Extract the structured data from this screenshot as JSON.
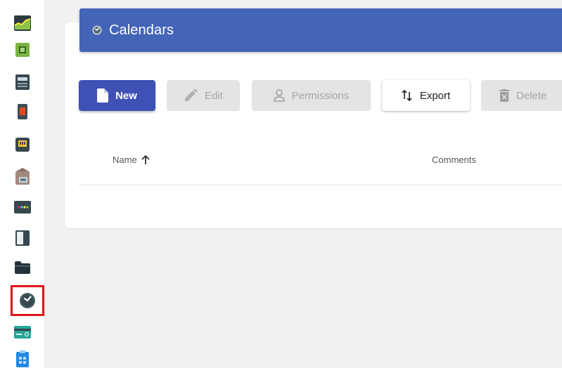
{
  "sidebar": {
    "items": [
      {
        "icon": "chart-icon"
      },
      {
        "icon": "chip-icon"
      },
      {
        "icon": "server-icon"
      },
      {
        "icon": "device-icon"
      },
      {
        "icon": "network-port-icon"
      },
      {
        "icon": "package-icon"
      },
      {
        "icon": "dashboard-icon"
      },
      {
        "icon": "panel-icon"
      },
      {
        "icon": "folder-icon"
      },
      {
        "icon": "clock-icon",
        "active": true
      },
      {
        "icon": "card-icon"
      },
      {
        "icon": "clipboard-icon"
      }
    ]
  },
  "header": {
    "title": "Calendars",
    "icon": "clock-icon"
  },
  "toolbar": {
    "new_label": "New",
    "edit_label": "Edit",
    "permissions_label": "Permissions",
    "export_label": "Export",
    "delete_label": "Delete"
  },
  "table": {
    "columns": [
      "Name",
      "Comments"
    ],
    "sort_column": "Name",
    "sort_direction": "ascending",
    "rows": []
  },
  "colors": {
    "header": "#4464b8",
    "primary_button": "#3f51b5",
    "active_outline": "#e0141c"
  }
}
